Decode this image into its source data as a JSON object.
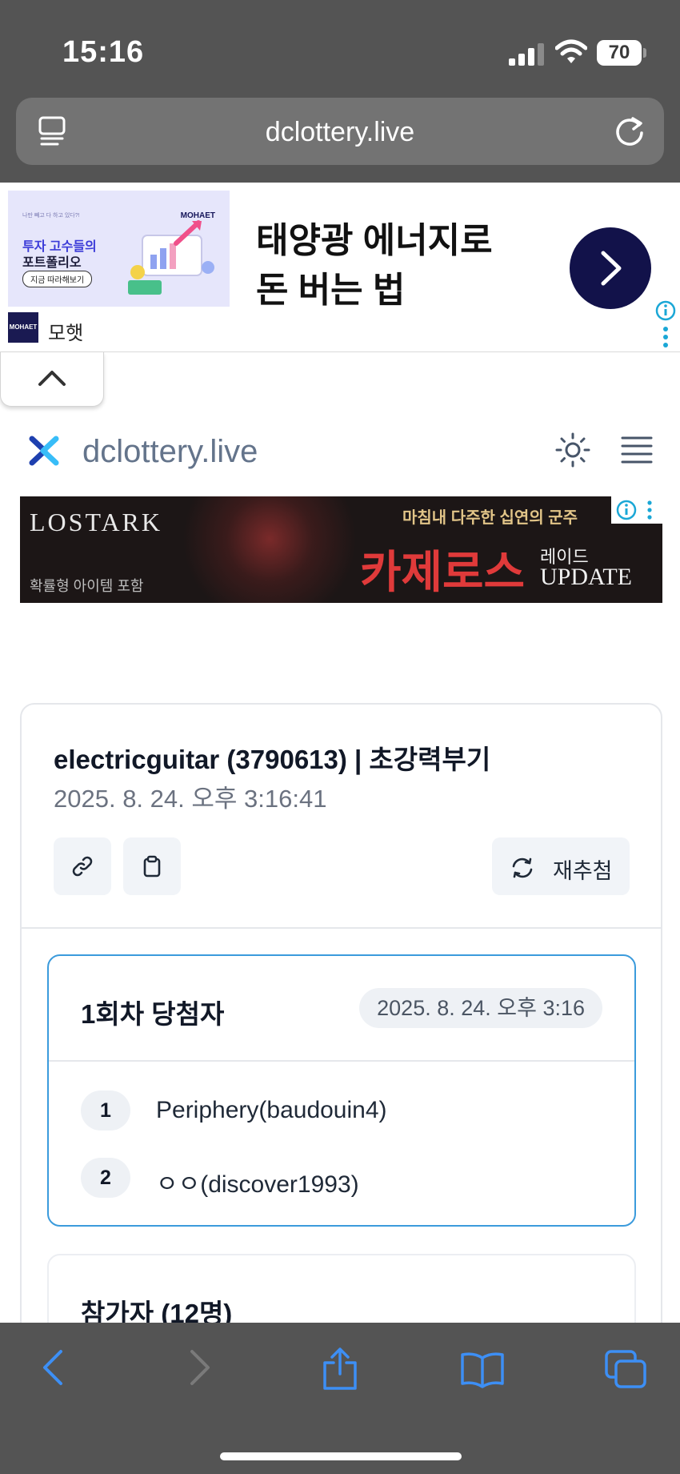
{
  "status_bar": {
    "time": "15:16",
    "battery": "70"
  },
  "browser": {
    "url": "dclottery.live"
  },
  "top_ad": {
    "image_small_text": "나만 빼고 다 하고 있다?!",
    "image_headline_1": "투자 고수들의",
    "image_headline_2": "포트폴리오",
    "image_button": "지금 따라해보기",
    "image_brand": "MOHAET",
    "headline_line1": "태양광 에너지로",
    "headline_line2": "돈 버는 법",
    "brand_logo": "MOHAET",
    "brand_name": "모햇"
  },
  "site": {
    "title": "dclottery.live"
  },
  "game_ad": {
    "logo": "LOSTARK",
    "left_caption": "확률형 아이템 포함",
    "tagline": "마침내 다주한 십연의 군주",
    "main": "카제로스",
    "raid": "레이드",
    "update": "UPDATE"
  },
  "result": {
    "title": "electricguitar (3790613) | 초강력부기",
    "datetime": "2025. 8. 24. 오후 3:16:41",
    "redraw_label": "재추첨",
    "winners": {
      "heading": "1회차 당첨자",
      "date": "2025. 8. 24. 오후 3:16",
      "list": [
        {
          "rank": "1",
          "name": "Periphery(baudouin4)"
        },
        {
          "rank": "2",
          "name": "ㅇㅇ(discover1993)"
        }
      ]
    },
    "participants_heading": "참가자 (12명)"
  }
}
